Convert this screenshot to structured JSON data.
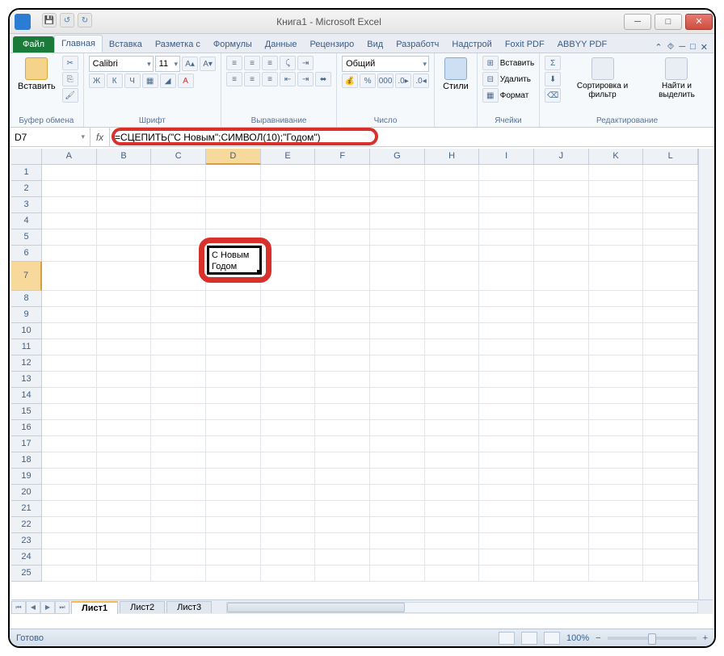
{
  "window": {
    "title": "Книга1 - Microsoft Excel"
  },
  "qat": {
    "save": "💾",
    "undo": "↺",
    "redo": "↻"
  },
  "tabs": {
    "file": "Файл",
    "items": [
      "Главная",
      "Вставка",
      "Разметка с",
      "Формулы",
      "Данные",
      "Рецензиро",
      "Вид",
      "Разработч",
      "Надстрой",
      "Foxit PDF",
      "ABBYY PDF"
    ],
    "activeIndex": 0,
    "help": "⯑"
  },
  "ribbon": {
    "clipboard": {
      "label": "Буфер обмена",
      "paste": "Вставить"
    },
    "font": {
      "label": "Шрифт",
      "name": "Calibri",
      "size": "11",
      "bold": "Ж",
      "italic": "К",
      "underline": "Ч"
    },
    "align": {
      "label": "Выравнивание"
    },
    "number": {
      "label": "Число",
      "format": "Общий"
    },
    "styles": {
      "label": "",
      "btn": "Стили"
    },
    "cells": {
      "label": "Ячейки",
      "insert": "Вставить",
      "delete": "Удалить",
      "format": "Формат"
    },
    "editing": {
      "label": "Редактирование",
      "sort": "Сортировка и фильтр",
      "find": "Найти и выделить"
    }
  },
  "namebox": "D7",
  "fx": "fx",
  "formula": "=СЦЕПИТЬ(\"С Новым\";СИМВОЛ(10);\"Годом\")",
  "columns": [
    "A",
    "B",
    "C",
    "D",
    "E",
    "F",
    "G",
    "H",
    "I",
    "J",
    "K",
    "L"
  ],
  "rows": [
    "1",
    "2",
    "3",
    "4",
    "5",
    "6",
    "7",
    "8",
    "9",
    "10",
    "11",
    "12",
    "13",
    "14",
    "15",
    "16",
    "17",
    "18",
    "19",
    "20",
    "21",
    "22",
    "23",
    "24",
    "25"
  ],
  "selectedCol": 3,
  "selectedRow": 6,
  "cellD7": {
    "line1": "С Новым",
    "line2": "Годом"
  },
  "sheets": {
    "navs": [
      "⏮",
      "◀",
      "▶",
      "⏭"
    ],
    "tabs": [
      "Лист1",
      "Лист2",
      "Лист3"
    ],
    "activeIndex": 0
  },
  "status": {
    "ready": "Готово",
    "zoom": "100%",
    "minus": "−",
    "plus": "+"
  },
  "winbtns": {
    "min": "─",
    "max": "□",
    "close": "✕"
  }
}
